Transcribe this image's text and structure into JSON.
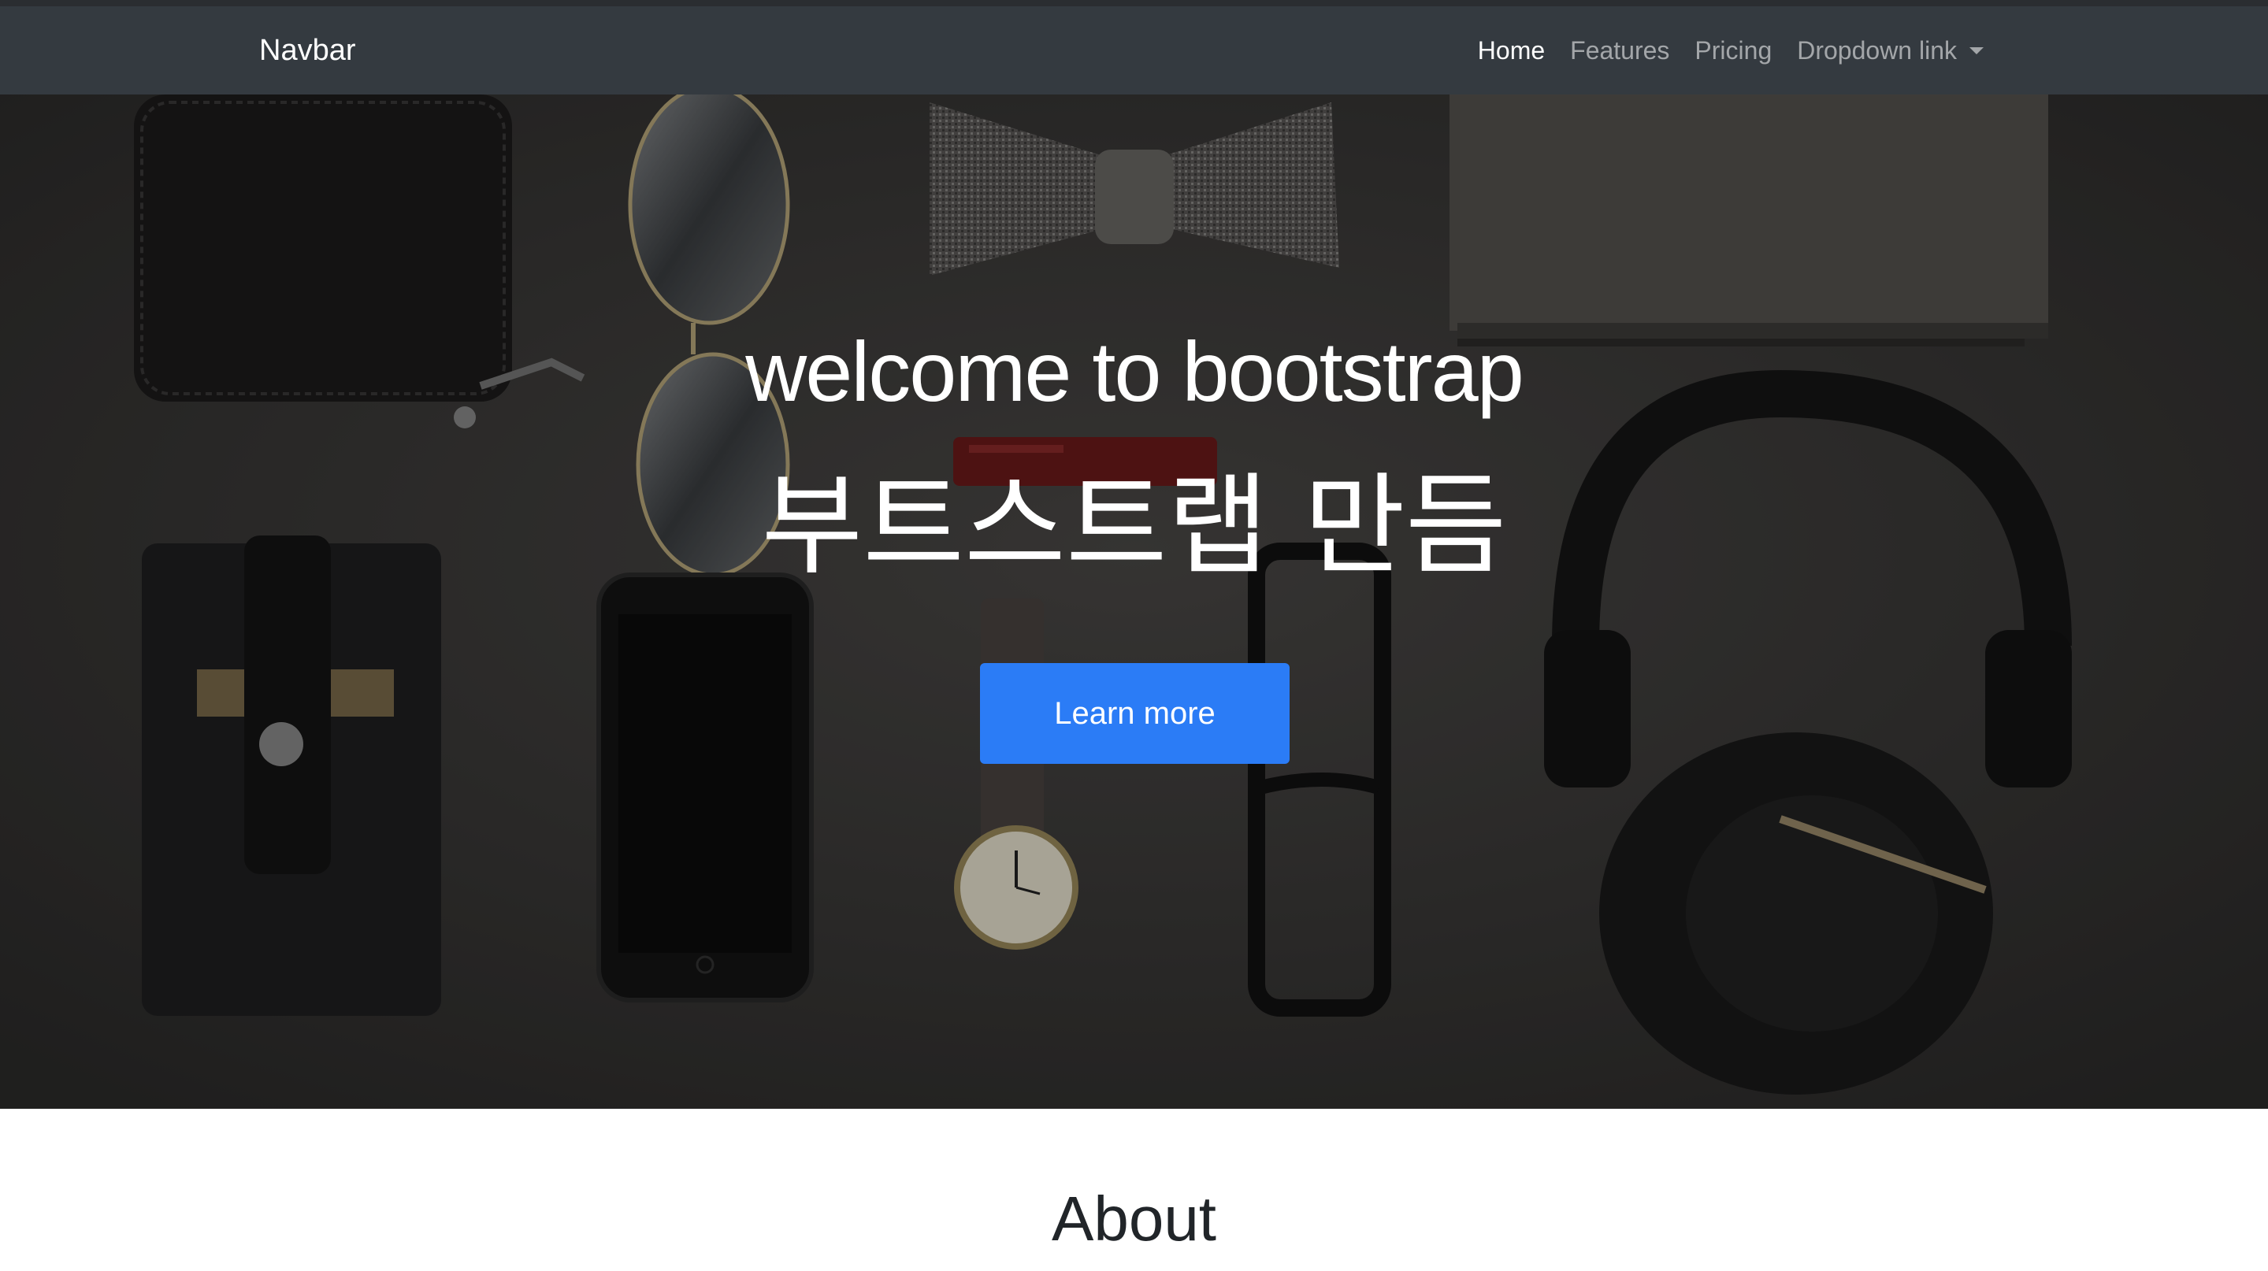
{
  "navbar": {
    "brand": "Navbar",
    "items": [
      {
        "label": "Home",
        "active": true
      },
      {
        "label": "Features",
        "active": false
      },
      {
        "label": "Pricing",
        "active": false
      },
      {
        "label": "Dropdown link",
        "active": false,
        "has_dropdown": true
      }
    ]
  },
  "hero": {
    "title": "welcome to bootstrap",
    "subtitle": "부트스트랩 만듬",
    "cta_label": "Learn more",
    "background_description_icons": [
      "wallet",
      "aviator-sunglasses",
      "bow-tie",
      "notebook",
      "smartphone",
      "wristwatch",
      "eyeglasses",
      "headphones",
      "card-sleeve",
      "pocket-knife"
    ]
  },
  "about": {
    "heading": "About"
  },
  "colors": {
    "navbar_bg": "#343a40",
    "primary_button": "#2b7cf6",
    "hero_bg": "#2f2e2d",
    "text_dark": "#212529"
  }
}
